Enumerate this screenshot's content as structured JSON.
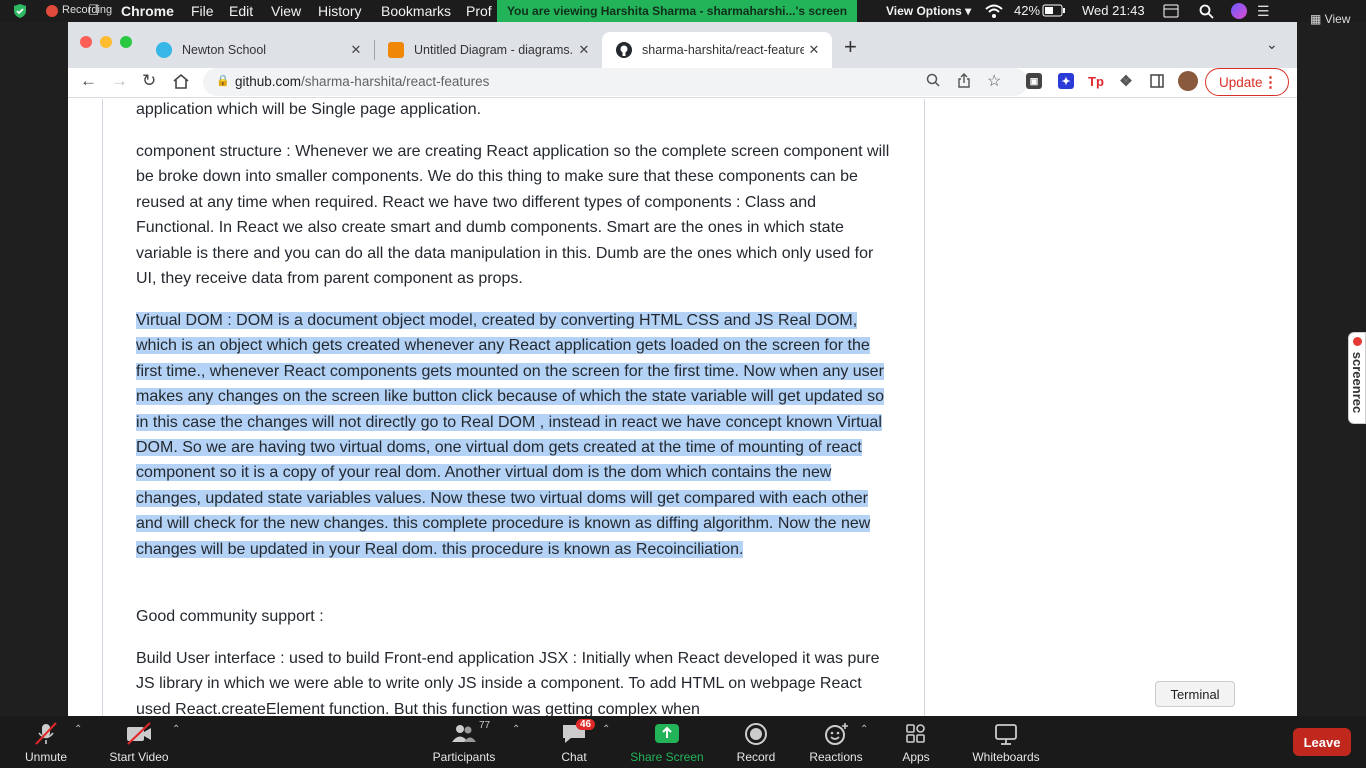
{
  "menubar": {
    "recording_label": "Recording",
    "app_name": "Chrome",
    "menus": [
      "File",
      "Edit",
      "View",
      "History",
      "Bookmarks",
      "Prof"
    ],
    "banner": "You are viewing Harshita Sharma - sharmaharshi...'s screen",
    "view_options": "View Options",
    "battery": "42%",
    "clock": "Wed 21:43"
  },
  "zoom_view": "View",
  "tabs": [
    {
      "title": "Newton School",
      "close": "✕",
      "favicon_color": "#37b6e8"
    },
    {
      "title": "Untitled Diagram - diagrams.net",
      "close": "✕",
      "favicon_color": "#f08705"
    },
    {
      "title": "sharma-harshita/react-features",
      "close": "✕",
      "favicon_color": "#24292f"
    }
  ],
  "newtab": "+",
  "address": {
    "host": "github.com",
    "path": "/sharma-harshita/react-features"
  },
  "update_label": "Update",
  "article": {
    "p0": "application which will be Single page application.",
    "p1": "component structure : Whenever we are creating React application so the complete screen component will be broke down into smaller components. We do this thing to make sure that these components can be reused at any time when required. React we have two different types of components : Class and Functional. In React we also create smart and dumb components. Smart are the ones in which state variable is there and you can do all the data manipulation in this. Dumb are the ones which only used for UI, they receive data from parent component as props.",
    "p2": "Virtual DOM : DOM is a document object model, created by converting HTML CSS and JS Real DOM, which is an object which gets created whenever any React application gets loaded on the screen for the first time., whenever React components gets mounted on the screen for the first time. Now when any user makes any changes on the screen like button click because of which the state variable will get updated so in this case the changes will not directly go to Real DOM , instead in react we have concept known Virtual DOM. So we are having two virtual doms, one virtual dom gets created at the time of mounting of react component so it is a copy of your real dom. Another virtual dom is the dom which contains the new changes, updated state variables values. Now these two virtual doms will get compared with each other and will check for the new changes. this complete procedure is known as diffing algorithm. Now the new changes will be updated in your Real dom. this procedure is known as Recoinciliation.",
    "p3": "Good community support :",
    "p4": "Build User interface : used to build Front-end application JSX : Initially when React developed it was pure JS library in which we were able to write only JS inside a component. To add HTML on webpage React used React.createElement function. But this function was getting complex when"
  },
  "terminal_tooltip": "Terminal",
  "screenrec_label": "screenrec",
  "zoom": {
    "unmute": "Unmute",
    "start_video": "Start Video",
    "participants": "Participants",
    "participants_count": "77",
    "chat": "Chat",
    "chat_badge": "46",
    "share_screen": "Share Screen",
    "record": "Record",
    "reactions": "Reactions",
    "apps": "Apps",
    "whiteboards": "Whiteboards",
    "leave": "Leave"
  },
  "colors": {
    "share_green": "#23b45a",
    "leave_red": "#c0281e",
    "selection": "#b4d2f5",
    "update_red": "#d93025"
  }
}
